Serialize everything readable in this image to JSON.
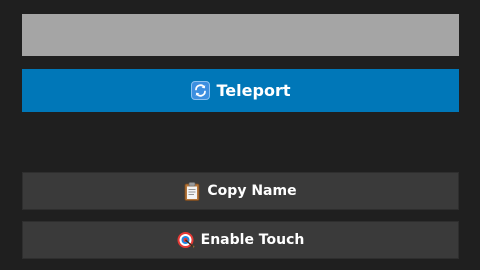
{
  "search": {
    "value": "",
    "placeholder": ""
  },
  "buttons": {
    "teleport_label": "Teleport",
    "teleport_icon": "refresh-icon",
    "copy_name_label": "Copy Name",
    "copy_name_icon": "clipboard-icon",
    "enable_touch_label": "Enable Touch",
    "enable_touch_icon": "target-icon"
  },
  "colors": {
    "background": "#1f1f1f",
    "input": "#a5a5a5",
    "primary": "#0077b8",
    "secondary": "#3a3a3a",
    "text": "#ffffff"
  }
}
